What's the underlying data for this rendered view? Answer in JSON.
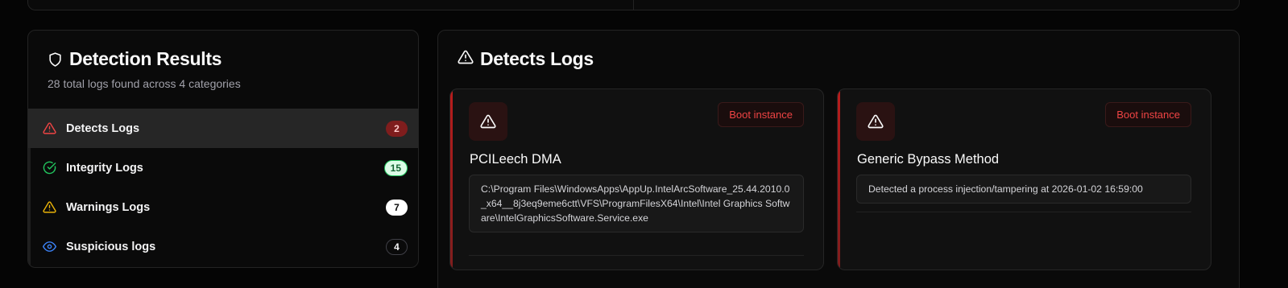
{
  "detection_results": {
    "title": "Detection Results",
    "subtitle": "28 total logs found across 4 categories",
    "categories": [
      {
        "label": "Detects Logs",
        "count": "2",
        "icon": "alert-triangle-icon",
        "color": "#ef4444",
        "active": true
      },
      {
        "label": "Integrity Logs",
        "count": "15",
        "icon": "check-circle-icon",
        "color": "#22c55e",
        "active": false
      },
      {
        "label": "Warnings Logs",
        "count": "7",
        "icon": "warning-triangle-icon",
        "color": "#eab308",
        "active": false
      },
      {
        "label": "Suspicious logs",
        "count": "4",
        "icon": "eye-icon",
        "color": "#3b82f6",
        "active": false
      }
    ]
  },
  "detects_logs": {
    "title": "Detects Logs",
    "entries": [
      {
        "name": "PCILeech DMA",
        "action": "Boot instance",
        "detail": "C:\\Program Files\\WindowsApps\\AppUp.IntelArcSoftware_25.44.2010.0_x64__8j3eq9eme6ctt\\VFS\\ProgramFilesX64\\Intel\\Intel Graphics Software\\IntelGraphicsSoftware.Service.exe"
      },
      {
        "name": "Generic Bypass Method",
        "action": "Boot instance",
        "detail": "Detected a process injection/tampering at 2026-01-02 16:59:00"
      }
    ]
  },
  "colors": {
    "accent_red": "#ef4444",
    "background": "#050505",
    "card": "#0a0a0a"
  }
}
